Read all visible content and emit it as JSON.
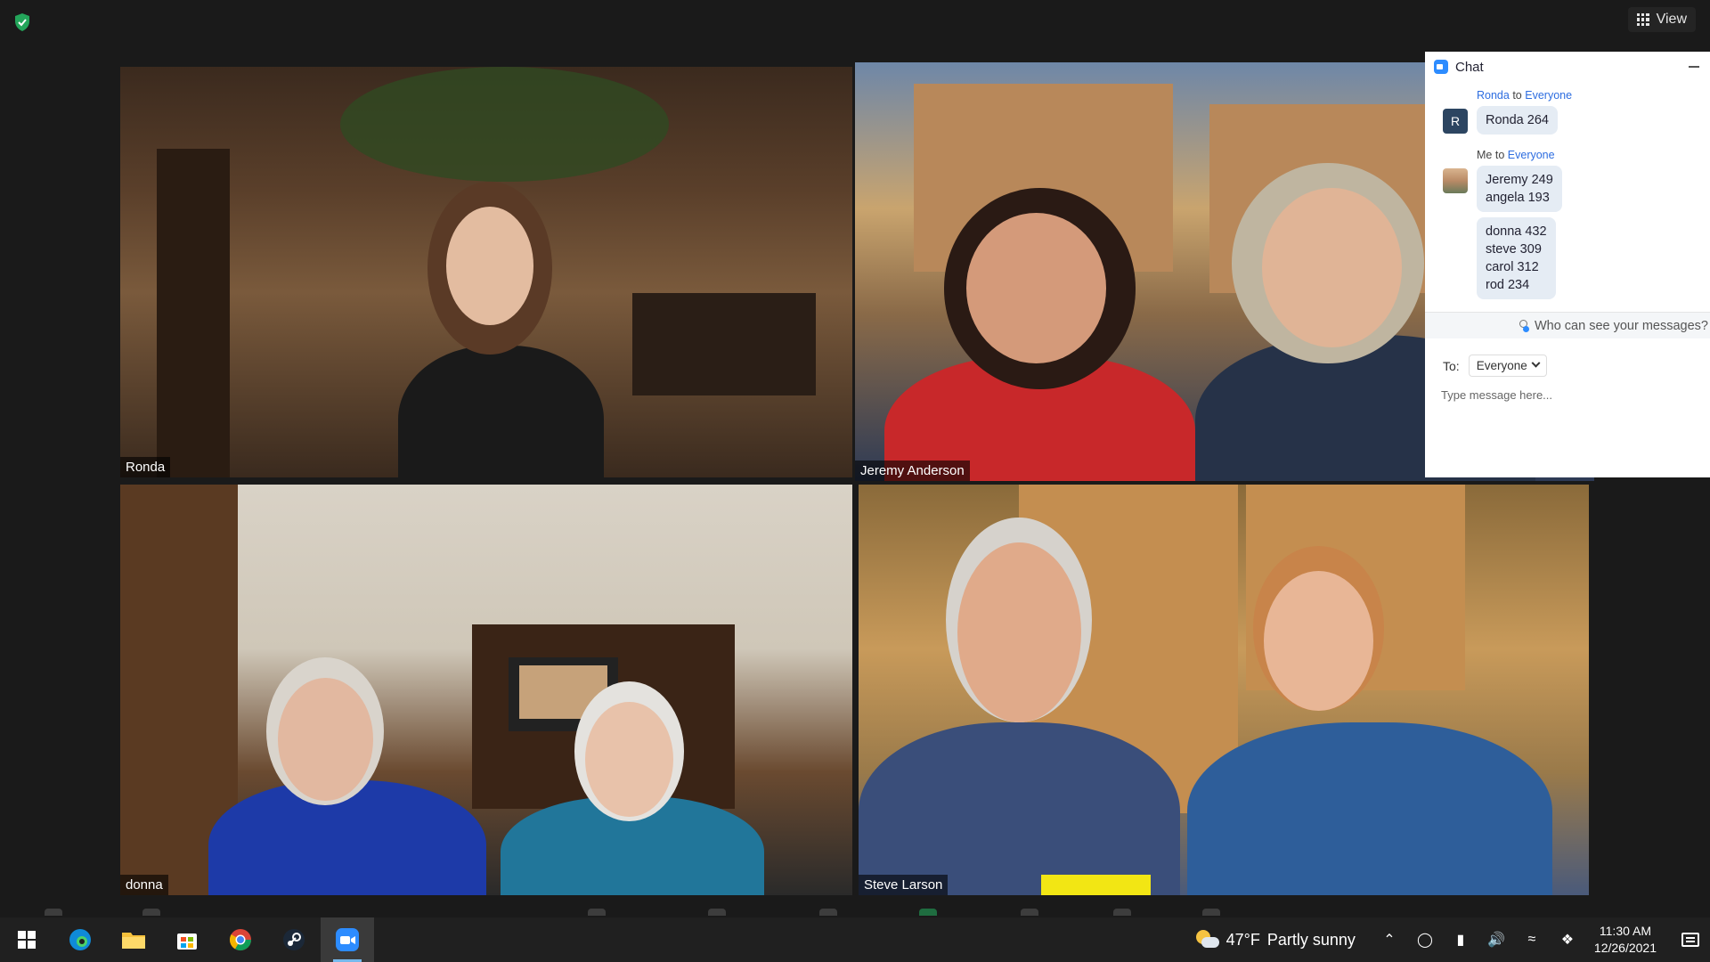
{
  "top_bar": {
    "view_label": "View"
  },
  "tiles": [
    {
      "name": "Ronda",
      "active": false
    },
    {
      "name": "Jeremy Anderson",
      "active": true
    },
    {
      "name": "donna",
      "active": false
    },
    {
      "name": "Steve Larson",
      "active": false
    }
  ],
  "chat": {
    "title": "Chat",
    "groups": [
      {
        "sender": "Ronda",
        "to_word": "to",
        "recipient": "Everyone",
        "avatar_letter": "R",
        "messages": [
          "Ronda 264"
        ]
      },
      {
        "sender": "Me",
        "to_word": "to",
        "recipient": "Everyone",
        "messages": [
          "Jeremy 249\nangela 193",
          "donna 432\nsteve 309\ncarol 312\nrod 234"
        ]
      }
    ],
    "who_can_see": "Who can see your messages?",
    "to_label": "To:",
    "to_value": "Everyone",
    "input_placeholder": "Type message here..."
  },
  "taskbar": {
    "apps": [
      "start-icon",
      "edge-icon",
      "file-explorer-icon",
      "microsoft-store-icon",
      "chrome-icon",
      "steam-icon",
      "zoom-icon"
    ],
    "active_app": "zoom-icon",
    "weather": {
      "temp": "47°F",
      "condition": "Partly sunny"
    },
    "time": "11:30 AM",
    "date": "12/26/2021"
  },
  "colors": {
    "active_speaker": "#d9e26b",
    "link_blue": "#2d6de0",
    "zoom_blue": "#2d8cff",
    "bubble": "#e5ecf4"
  }
}
